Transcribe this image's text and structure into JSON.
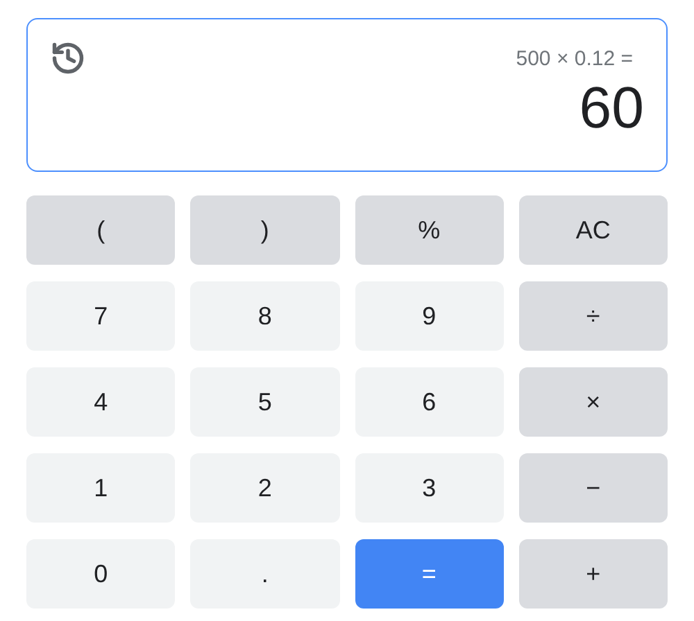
{
  "display": {
    "expression": "500 × 0.12 =",
    "result": "60"
  },
  "keys": [
    {
      "label": "(",
      "kind": "function"
    },
    {
      "label": ")",
      "kind": "function"
    },
    {
      "label": "%",
      "kind": "function"
    },
    {
      "label": "AC",
      "kind": "function"
    },
    {
      "label": "7",
      "kind": "digit"
    },
    {
      "label": "8",
      "kind": "digit"
    },
    {
      "label": "9",
      "kind": "digit"
    },
    {
      "label": "÷",
      "kind": "function"
    },
    {
      "label": "4",
      "kind": "digit"
    },
    {
      "label": "5",
      "kind": "digit"
    },
    {
      "label": "6",
      "kind": "digit"
    },
    {
      "label": "×",
      "kind": "function"
    },
    {
      "label": "1",
      "kind": "digit"
    },
    {
      "label": "2",
      "kind": "digit"
    },
    {
      "label": "3",
      "kind": "digit"
    },
    {
      "label": "−",
      "kind": "function"
    },
    {
      "label": "0",
      "kind": "digit"
    },
    {
      "label": ".",
      "kind": "digit"
    },
    {
      "label": "=",
      "kind": "equals"
    },
    {
      "label": "+",
      "kind": "function"
    }
  ]
}
